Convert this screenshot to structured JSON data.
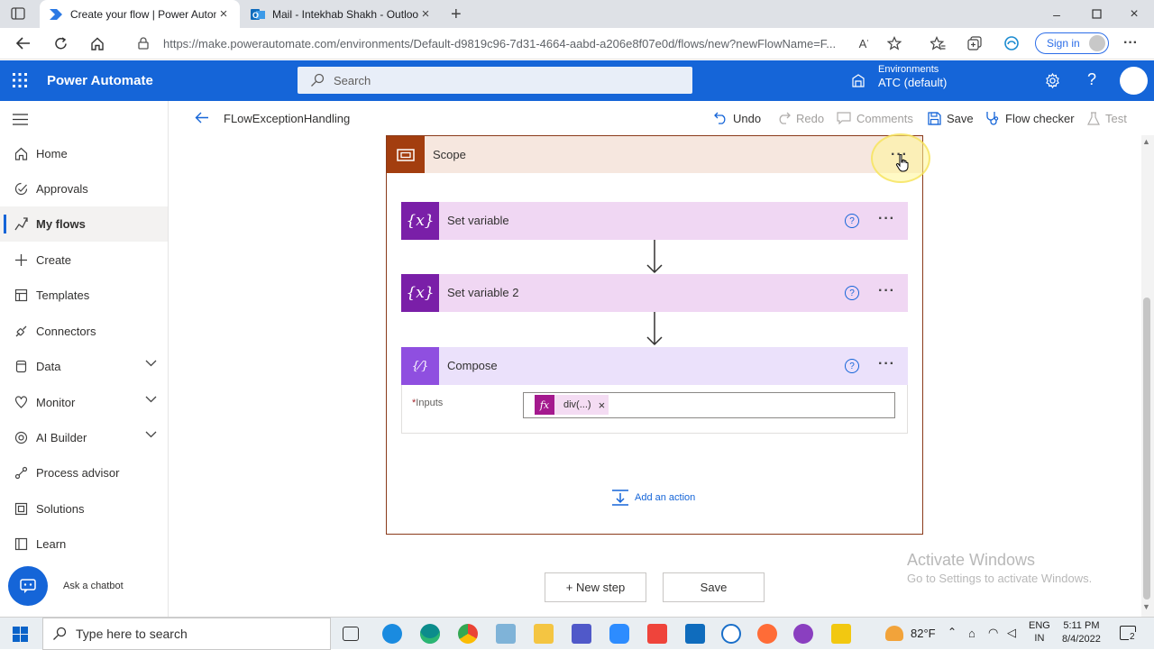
{
  "browser": {
    "tabs": [
      {
        "title": "Create your flow | Power Automate",
        "active": true
      },
      {
        "title": "Mail - Intekhab Shakh - Outlook",
        "active": false
      }
    ],
    "url": "https://make.powerautomate.com/environments/Default-d9819c96-7d31-4664-aabd-a206e8f07e0d/flows/new?newFlowName=F...",
    "sign_in": "Sign in"
  },
  "header": {
    "brand": "Power Automate",
    "search_placeholder": "Search",
    "environments_label": "Environments",
    "environment_name": "ATC (default)"
  },
  "sidebar": {
    "items": [
      {
        "label": "Home",
        "icon": "home-icon"
      },
      {
        "label": "Approvals",
        "icon": "approvals-icon"
      },
      {
        "label": "My flows",
        "icon": "flows-icon",
        "active": true
      },
      {
        "label": "Create",
        "icon": "plus-icon"
      },
      {
        "label": "Templates",
        "icon": "templates-icon"
      },
      {
        "label": "Connectors",
        "icon": "connectors-icon"
      },
      {
        "label": "Data",
        "icon": "data-icon",
        "expandable": true
      },
      {
        "label": "Monitor",
        "icon": "monitor-icon",
        "expandable": true
      },
      {
        "label": "AI Builder",
        "icon": "ai-builder-icon",
        "expandable": true
      },
      {
        "label": "Process advisor",
        "icon": "process-advisor-icon"
      },
      {
        "label": "Solutions",
        "icon": "solutions-icon"
      },
      {
        "label": "Learn",
        "icon": "learn-icon"
      }
    ],
    "chatbot_label": "Ask a chatbot"
  },
  "command_bar": {
    "flow_name": "FLowExceptionHandling",
    "undo": "Undo",
    "redo": "Redo",
    "comments": "Comments",
    "save": "Save",
    "flow_checker": "Flow checker",
    "test": "Test"
  },
  "designer": {
    "scope_title": "Scope",
    "actions": [
      {
        "title": "Set variable",
        "icon_glyph": "{x}"
      },
      {
        "title": "Set variable 2",
        "icon_glyph": "{x}"
      },
      {
        "title": "Compose",
        "icon_glyph": "{⁄}"
      }
    ],
    "compose_inputs_required": "*",
    "compose_inputs_label": "Inputs",
    "compose_token_icon": "fx",
    "compose_token": "div(...)",
    "compose_token_remove": "×",
    "add_action": "Add an action",
    "new_step": "+ New step",
    "save_button": "Save",
    "more_dots": "···",
    "help_glyph": "?"
  },
  "watermark": {
    "line1": "Activate Windows",
    "line2": "Go to Settings to activate Windows."
  },
  "taskbar": {
    "search_placeholder": "Type here to search",
    "weather": "82°F",
    "lang_line1": "ENG",
    "lang_line2": "IN",
    "time": "5:11 PM",
    "date": "8/4/2022",
    "notification_count": "2"
  },
  "colors": {
    "header_blue": "#1565d8",
    "scope_orange": "#a33e0f",
    "variable_purple": "#7a1fa8",
    "compose_purple": "#8f4fe0"
  }
}
